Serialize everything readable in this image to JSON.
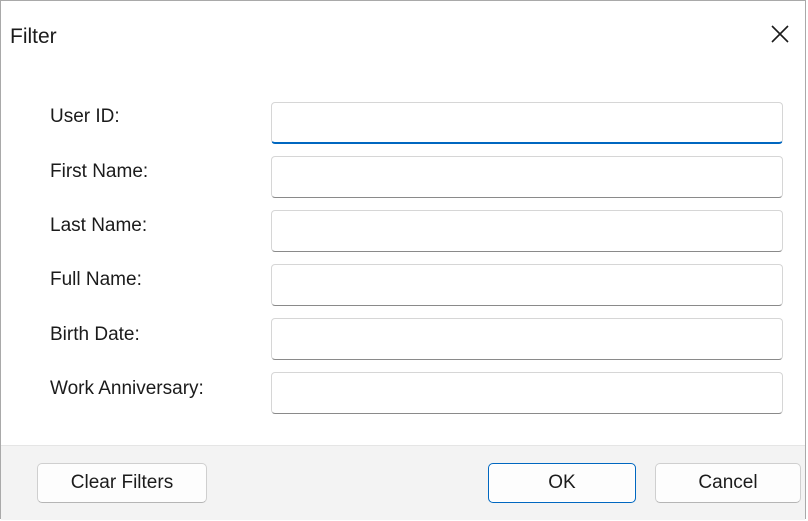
{
  "dialog": {
    "title": "Filter",
    "close_icon": "close-icon"
  },
  "fields": [
    {
      "label": "User ID:",
      "value": "",
      "focused": true
    },
    {
      "label": "First Name:",
      "value": ""
    },
    {
      "label": "Last Name:",
      "value": ""
    },
    {
      "label": "Full Name:",
      "value": ""
    },
    {
      "label": "Birth Date:",
      "value": ""
    },
    {
      "label": "Work Anniversary:",
      "value": ""
    }
  ],
  "buttons": {
    "clear_filters": "Clear Filters",
    "ok": "OK",
    "cancel": "Cancel"
  },
  "colors": {
    "accent": "#0067c0",
    "footer_bg": "#f3f3f3",
    "content_bg": "#ffffff"
  }
}
